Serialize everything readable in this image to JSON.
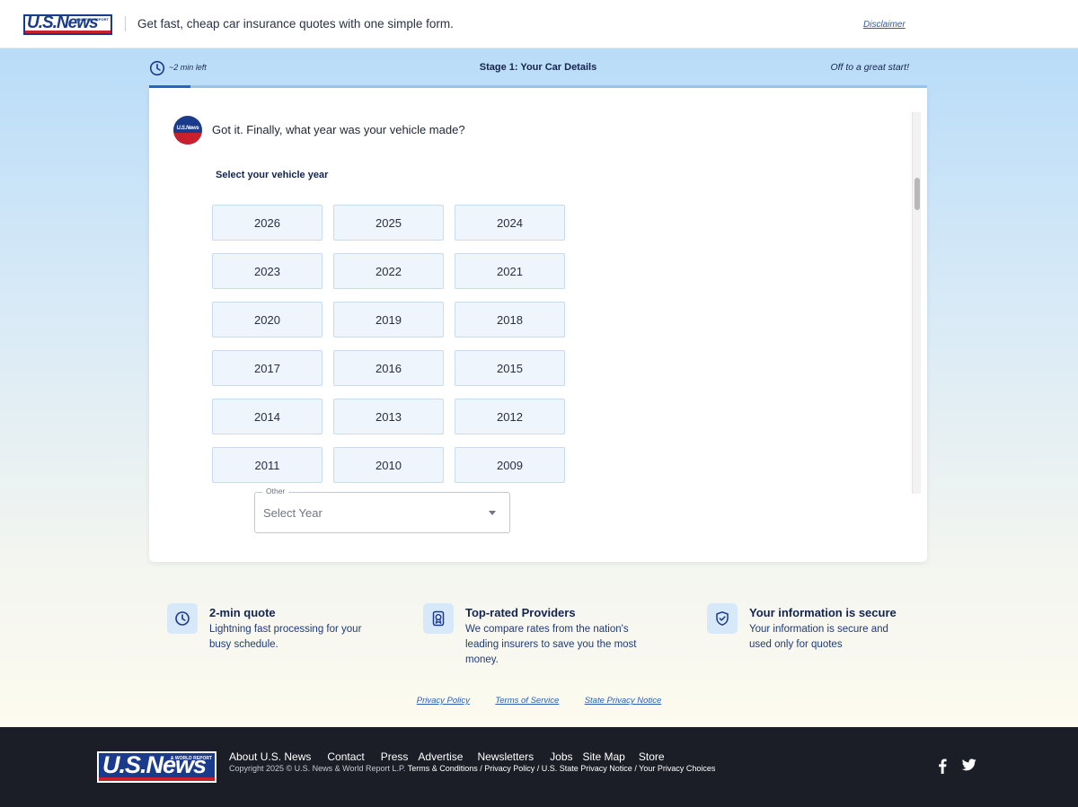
{
  "header": {
    "logo": "U.S.News",
    "logo_sub": "& WORLD REPORT",
    "tagline": "Get fast, cheap car insurance quotes with one simple form.",
    "disclaimer": "Disclaimer"
  },
  "progress": {
    "time_left": "~2 min left",
    "stage": "Stage 1: Your Car Details",
    "message": "Off to a great start!",
    "fill_fraction": 0.053
  },
  "card": {
    "avatar_text": "U.S.News",
    "question": "Got it. Finally, what year was your vehicle made?",
    "select_label": "Select your vehicle year",
    "years": [
      "2026",
      "2025",
      "2024",
      "2023",
      "2022",
      "2021",
      "2020",
      "2019",
      "2018",
      "2017",
      "2016",
      "2015",
      "2014",
      "2013",
      "2012",
      "2011",
      "2010",
      "2009"
    ],
    "other": {
      "label": "Other",
      "value": "Select Year"
    }
  },
  "features": [
    {
      "icon": "clock-icon",
      "title": "2-min quote",
      "desc": "Lightning fast processing for your busy schedule."
    },
    {
      "icon": "award-icon",
      "title": "Top-rated Providers",
      "desc": "We compare rates from the nation's leading insurers to save you the most money."
    },
    {
      "icon": "shield-check-icon",
      "title": "Your information is secure",
      "desc": "Your information is secure and used only for quotes"
    }
  ],
  "legal_links": [
    "Privacy Policy",
    "Terms of Service",
    "State Privacy Notice"
  ],
  "footer": {
    "logo": "U.S.News",
    "logo_sub": "& WORLD REPORT",
    "nav": [
      "About U.S. News",
      "Contact",
      "Press",
      "Advertise",
      "Newsletters",
      "Jobs",
      "Site Map",
      "Store"
    ],
    "copyright": "Copyright 2025 © U.S. News & World Report L.P.",
    "copyright_links": "Terms & Conditions / Privacy Policy / U.S. State Privacy Notice / Your Privacy Choices",
    "social": [
      "facebook-icon",
      "twitter-icon"
    ]
  },
  "colors": {
    "brand_blue": "#1a3a8c",
    "brand_red": "#c9202e",
    "accent": "#2567c8",
    "footer_bg": "#1b1e26"
  }
}
